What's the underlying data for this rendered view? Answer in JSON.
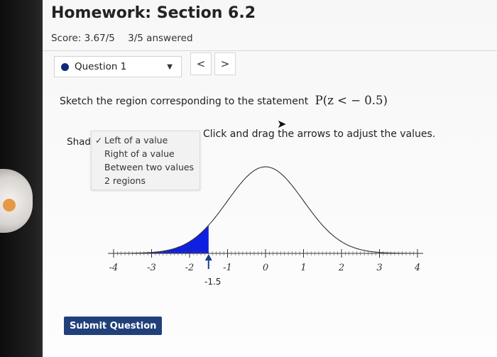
{
  "header": {
    "title": "Homework: Section 6.2",
    "score": "Score: 3.67/5",
    "answered": "3/5 answered"
  },
  "question_nav": {
    "current": "Question 1",
    "prev_icon": "<",
    "next_icon": ">"
  },
  "prompt": {
    "text": "Sketch the region corresponding to the statement",
    "math": "P(z < − 0.5)"
  },
  "shade": {
    "label": "Shade",
    "options": [
      "Left of a value",
      "Right of a value",
      "Between two values",
      "2 regions"
    ],
    "selected_index": 0
  },
  "instructions": "Click and drag the arrows to adjust the values.",
  "graph": {
    "axis_ticks": [
      "-4",
      "-3",
      "-2",
      "-1",
      "0",
      "1",
      "2",
      "3",
      "4"
    ],
    "marker_value": -1.5,
    "marker_label": "-1.5",
    "shaded_to": -1.5,
    "shade_color": "#1020e0"
  },
  "submit_label": "Submit Question"
}
